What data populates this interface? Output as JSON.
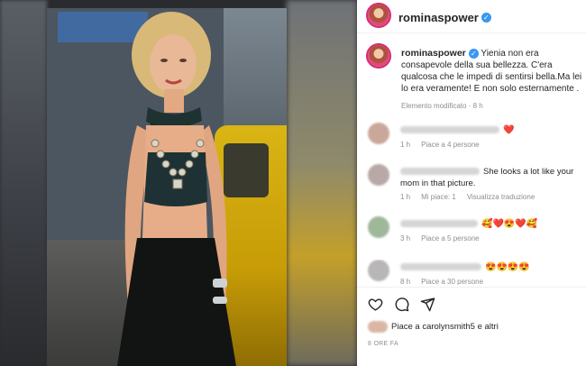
{
  "post": {
    "username": "rominaspower",
    "caption": "Yienia non era consapevole della sua bellezza. C'era qualcosa che le impedi di sentirsi bella.Ma lei lo era veramente! E non solo esternamente .",
    "edited_label": "Elemento modificato",
    "edited_time": "8 h"
  },
  "comments": [
    {
      "text": "",
      "emoji": "❤️",
      "time": "1 h",
      "likes": "Piace a 4 persone",
      "extra": "",
      "name_blur_width": 110,
      "avatar_color": "#c9a89a"
    },
    {
      "text": "She looks a lot like your mom in that picture.",
      "emoji": "",
      "time": "1 h",
      "likes": "Mi piace: 1",
      "extra": "Visualizza traduzione",
      "name_blur_width": 88,
      "avatar_color": "#b8a8a6"
    },
    {
      "text": "",
      "emoji": "🥰❤️😍❤️🥰",
      "time": "3 h",
      "likes": "Piace a 5 persone",
      "extra": "",
      "name_blur_width": 86,
      "avatar_color": "#9fb89a"
    },
    {
      "text": "",
      "emoji": "😍😍😍😍",
      "time": "8 h",
      "likes": "Piace a 30 persone",
      "extra": "",
      "name_blur_width": 90,
      "avatar_color": "#b9b6b8"
    }
  ],
  "liked_by": "Piace a carolynsmith5 e altri",
  "timestamp": "8 ORE FA",
  "icons": {
    "like": "heart-icon",
    "comment": "comment-icon",
    "share": "share-icon",
    "verified": "verified-badge-icon"
  },
  "colors": {
    "verified": "#3897f0",
    "heart": "#ed4956",
    "meta": "#8e8e8e"
  }
}
